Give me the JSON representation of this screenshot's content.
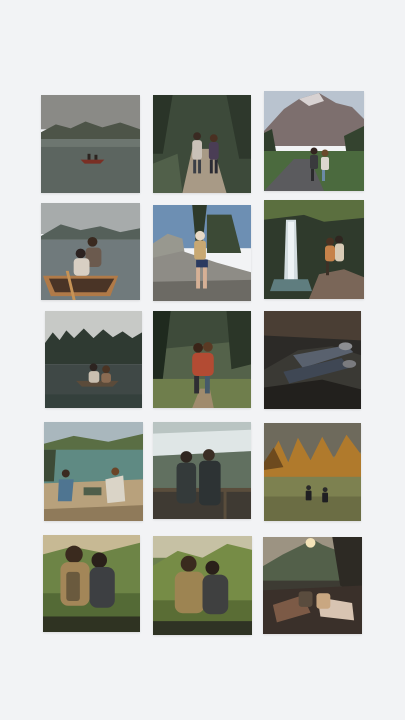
{
  "gallery": {
    "background": "#f2f3f5",
    "photos": [
      {
        "id": "p1",
        "subject": "canoe-on-lake-photo"
      },
      {
        "id": "p2",
        "subject": "couple-walking-forest-trail-photo"
      },
      {
        "id": "p3",
        "subject": "couple-on-mountain-road-photo"
      },
      {
        "id": "p4",
        "subject": "couple-in-canoe-photo"
      },
      {
        "id": "p5",
        "subject": "couple-on-boulder-photo"
      },
      {
        "id": "p6",
        "subject": "couple-at-waterfall-photo"
      },
      {
        "id": "p7",
        "subject": "canoe-misty-lake-photo"
      },
      {
        "id": "p8",
        "subject": "couple-embracing-forest-photo"
      },
      {
        "id": "p9",
        "subject": "couple-resting-feet-photo"
      },
      {
        "id": "p10",
        "subject": "camp-chairs-lakeside-photo"
      },
      {
        "id": "p11",
        "subject": "couple-at-overlook-railing-photo"
      },
      {
        "id": "p12",
        "subject": "couple-hiking-autumn-meadow-photo"
      },
      {
        "id": "p13",
        "subject": "couple-sitting-sunset-photo"
      },
      {
        "id": "p14",
        "subject": "couple-sitting-mountain-view-photo"
      },
      {
        "id": "p15",
        "subject": "hands-holding-mugs-sunset-photo"
      }
    ]
  }
}
